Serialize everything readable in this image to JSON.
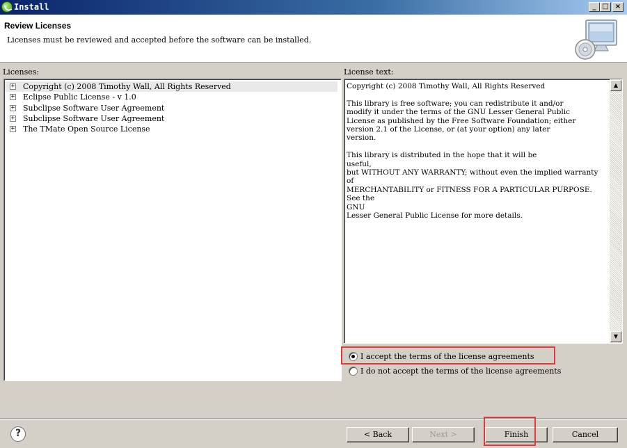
{
  "window": {
    "title": "Install",
    "controls": [
      "_",
      "□",
      "×"
    ]
  },
  "header": {
    "title": "Review Licenses",
    "description": "Licenses must be reviewed and accepted before the software can be installed."
  },
  "licenses": {
    "label": "Licenses:",
    "items": [
      {
        "label": "Copyright (c) 2008 Timothy Wall, All Rights Reserved",
        "expander": "+",
        "selected": true
      },
      {
        "label": "Eclipse Public License - v 1.0",
        "expander": "+"
      },
      {
        "label": "Subclipse Software User Agreement",
        "expander": "+"
      },
      {
        "label": "Subclipse Software User Agreement",
        "expander": "+"
      },
      {
        "label": "The TMate Open Source License",
        "expander": "+"
      }
    ]
  },
  "license_text": {
    "label": "License text:",
    "content": "Copyright (c) 2008 Timothy Wall, All Rights Reserved\n\nThis library is free software; you can redistribute it and/or\nmodify it under the terms of the GNU Lesser General Public\nLicense as published by the Free Software Foundation; either\nversion 2.1 of the License, or (at your option) any later\nversion.\n\nThis library is distributed in the hope that it will be\nuseful,\nbut WITHOUT ANY WARRANTY; without even the implied warranty\nof\nMERCHANTABILITY or FITNESS FOR A PARTICULAR PURPOSE.  See the\nGNU\nLesser General Public License for more details.",
    "scroll_up": "▲",
    "scroll_down": "▼"
  },
  "acceptance": {
    "accept_label": "I accept the terms of the license agreements",
    "decline_label": "I do not accept the terms of the license agreements",
    "selected": "accept"
  },
  "buttons": {
    "help": "?",
    "back": "< Back",
    "next": "Next >",
    "finish": "Finish",
    "cancel": "Cancel"
  },
  "colors": {
    "highlight": "#e03a3a",
    "titlebar": "#0a246a"
  },
  "icons": {
    "title": "eclipse-leaf-icon",
    "header": "install-computer-cd-icon",
    "help": "help-question-icon"
  }
}
